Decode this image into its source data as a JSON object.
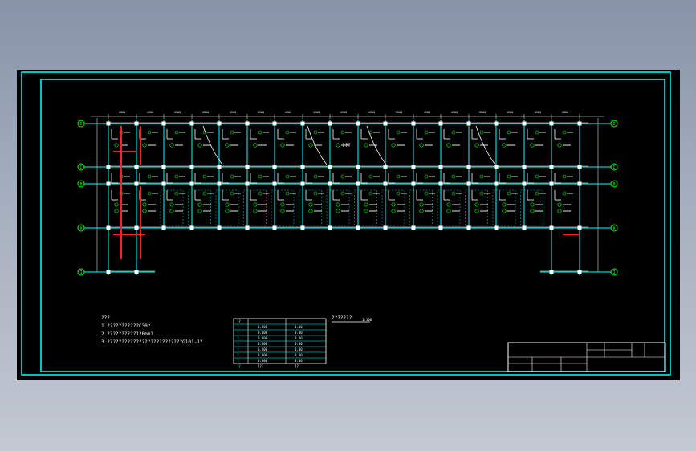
{
  "drawing": {
    "notes": {
      "heading": "???",
      "lines": [
        "1.???????????C30?",
        "2.??????????120mm?",
        "3.??????????????????????????G101-1?"
      ]
    },
    "scale_label": "???????",
    "scale_value": "1:100",
    "schedule": {
      "header": "??",
      "rows": [
        {
          "a": "?",
          "b": "0.000",
          "c": "0.00"
        },
        {
          "a": "?",
          "b": "0.000",
          "c": "0.00"
        },
        {
          "a": "?",
          "b": "0.000",
          "c": "0.00"
        },
        {
          "a": "?",
          "b": "0.000",
          "c": "0.00"
        },
        {
          "a": "?",
          "b": "0.000",
          "c": "0.00"
        },
        {
          "a": "?",
          "b": "0.000",
          "c": "0.00"
        },
        {
          "a": "?",
          "b": "0.000",
          "c": "0.00"
        },
        {
          "a": "??",
          "b": "???",
          "c": "??"
        }
      ]
    },
    "stair_label": "???",
    "bay_labels": [
      "4500",
      "4500",
      "4500",
      "4500",
      "4500",
      "4500",
      "4500",
      "4500",
      "4500",
      "4500",
      "4500",
      "4500",
      "4500",
      "4500",
      "4500",
      "4500"
    ],
    "grid_left": [
      "D",
      "C",
      "B",
      "A",
      "1"
    ],
    "grid_right": [
      "D",
      "C",
      "B",
      "A",
      "1"
    ],
    "colors": {
      "frame": "#00ffff",
      "grid": "#00ffff",
      "beam": "#ffffff",
      "red": "#ff2020",
      "green": "#00ff00",
      "background": "#000000"
    }
  }
}
